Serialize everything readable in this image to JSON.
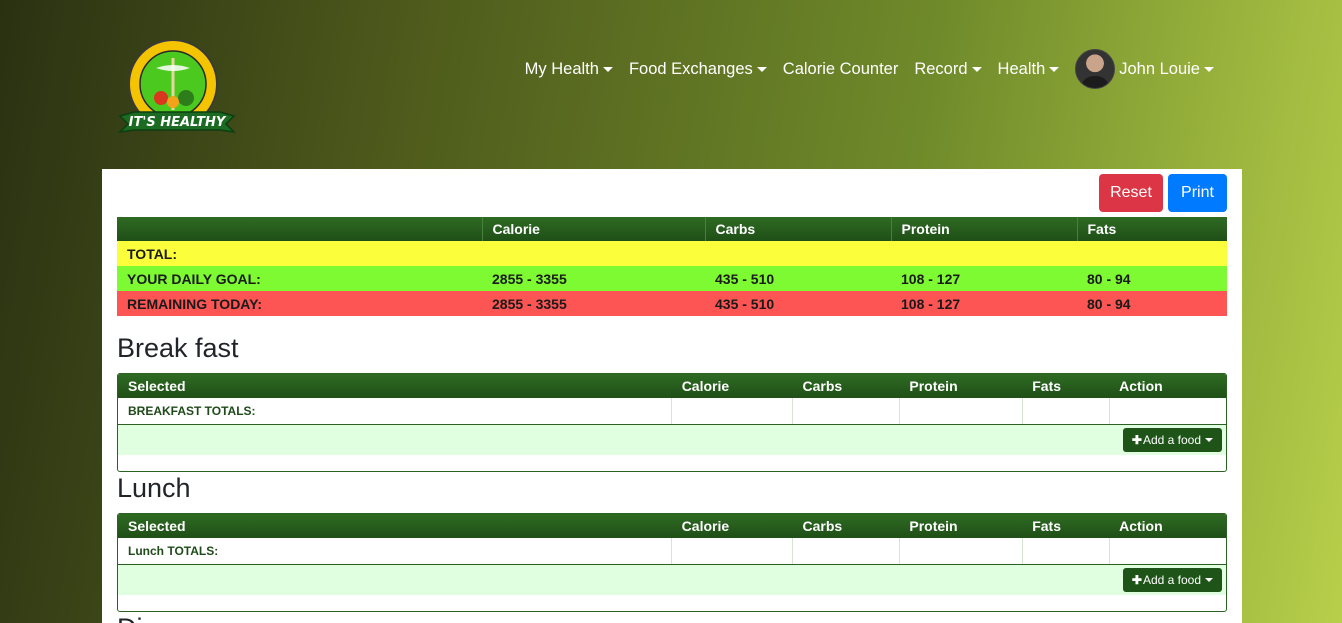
{
  "brand": {
    "logo_text": "IT'S HEALTHY",
    "logo_ring_text": "EMILIO J. GARCIA MEMORIAL RESEARCH AND MEDICAL"
  },
  "nav": [
    {
      "label": "My Health",
      "dropdown": true
    },
    {
      "label": "Food Exchanges",
      "dropdown": true
    },
    {
      "label": "Calorie Counter",
      "dropdown": false
    },
    {
      "label": "Record",
      "dropdown": true
    },
    {
      "label": "Health",
      "dropdown": true
    }
  ],
  "user": {
    "name": "John Louie"
  },
  "buttons": {
    "reset": "Reset",
    "print": "Print"
  },
  "summary": {
    "headers": [
      "",
      "Calorie",
      "Carbs",
      "Protein",
      "Fats"
    ],
    "rows": [
      {
        "label": "TOTAL:",
        "calorie": "",
        "carbs": "",
        "protein": "",
        "fats": ""
      },
      {
        "label": "YOUR DAILY GOAL:",
        "calorie": "2855 - 3355",
        "carbs": "435 - 510",
        "protein": "108 - 127",
        "fats": "80 - 94"
      },
      {
        "label": "REMAINING TODAY:",
        "calorie": "2855 - 3355",
        "carbs": "435 - 510",
        "protein": "108 - 127",
        "fats": "80 - 94"
      }
    ]
  },
  "meal_headers": [
    "Selected",
    "Calorie",
    "Carbs",
    "Protein",
    "Fats",
    "Action"
  ],
  "meals": [
    {
      "title": "Break fast",
      "totals_label": "BREAKFAST TOTALS:",
      "add_label": "Add a food"
    },
    {
      "title": "Lunch",
      "totals_label": "Lunch TOTALS:",
      "add_label": "Add a food"
    },
    {
      "title": "Di"
    }
  ],
  "colors": {
    "header_green": "#2f6b23",
    "total_yellow": "#fbff3b",
    "goal_green": "#7dfa31",
    "remaining_red": "#fd5454",
    "reset_red": "#dc3545",
    "print_blue": "#007bff",
    "footer_mint": "#e0ffe0"
  }
}
